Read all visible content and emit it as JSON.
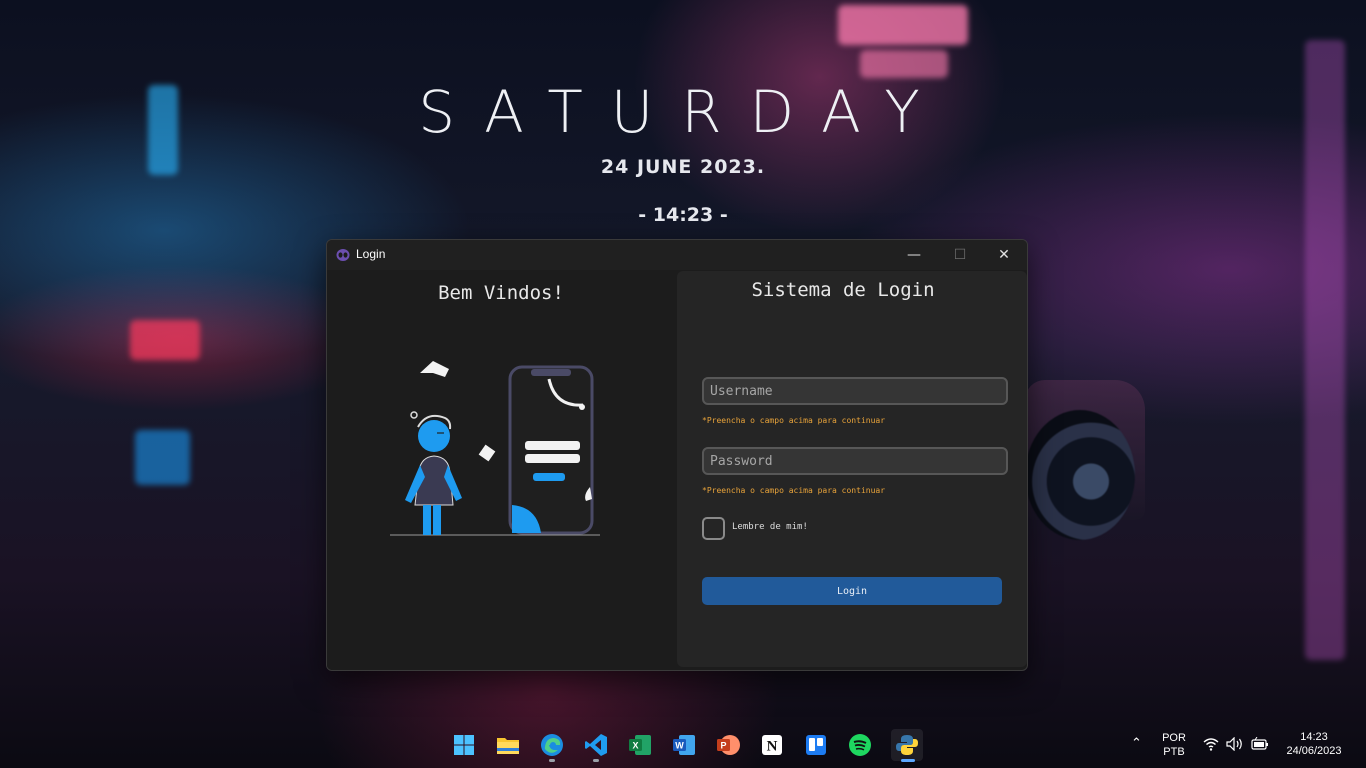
{
  "desktop": {
    "widget_day": "SATURDAY",
    "widget_date": "24  JUNE  2023.",
    "widget_time": "- 14:23 -"
  },
  "window": {
    "title": "Login",
    "app_icon": "alien-icon",
    "controls": {
      "minimize": "—",
      "maximize": "☐",
      "close": "✕"
    }
  },
  "left": {
    "welcome": "Bem Vindos!"
  },
  "form": {
    "title": "Sistema de Login",
    "username_placeholder": "Username",
    "username_hint": "*Preencha o campo acima para continuar",
    "password_placeholder": "Password",
    "password_hint": "*Preencha o campo acima para continuar",
    "remember_label": "Lembre de mim!",
    "remember_checked": false,
    "login_label": "Login"
  },
  "taskbar": {
    "apps": [
      "windows-start-icon",
      "file-explorer-icon",
      "edge-icon",
      "vscode-icon",
      "excel-icon",
      "word-icon",
      "powerpoint-icon",
      "notion-icon",
      "trello-icon",
      "spotify-icon",
      "python-icon"
    ],
    "language_line1": "POR",
    "language_line2": "PTB",
    "time": "14:23",
    "date": "24/06/2023"
  },
  "colors": {
    "accent": "#215a9a",
    "hint": "#e8a33a",
    "illustration_blue": "#1e9bf0"
  }
}
